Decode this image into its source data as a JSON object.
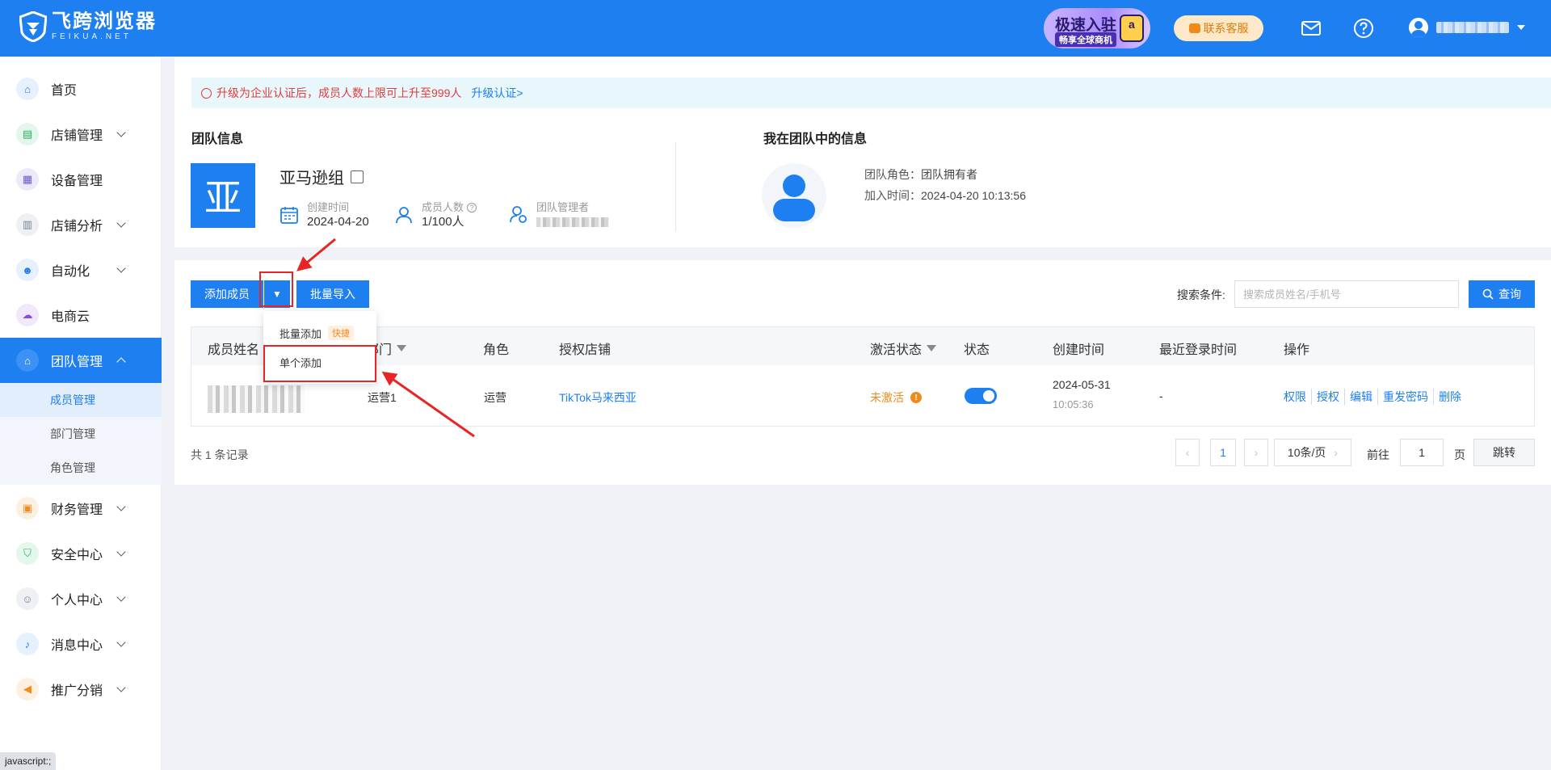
{
  "header": {
    "logo_cn": "飞跨浏览器",
    "logo_en": "FEIKUA.NET",
    "promo_line1": "极速入驻",
    "promo_line2": "畅享全球商机",
    "support_label": "联系客服",
    "mail_icon": "mail-icon",
    "help_icon": "help-icon",
    "brand_color": "#1e7ff0"
  },
  "sidebar": {
    "items": [
      {
        "label": "首页",
        "icon": "home-icon"
      },
      {
        "label": "店铺管理",
        "icon": "store-icon"
      },
      {
        "label": "设备管理",
        "icon": "device-icon"
      },
      {
        "label": "店铺分析",
        "icon": "analysis-icon"
      },
      {
        "label": "自动化",
        "icon": "robot-icon"
      },
      {
        "label": "电商云",
        "icon": "cloud-icon"
      },
      {
        "label": "团队管理",
        "icon": "team-icon"
      },
      {
        "label": "财务管理",
        "icon": "wallet-icon"
      },
      {
        "label": "安全中心",
        "icon": "shield-icon"
      },
      {
        "label": "个人中心",
        "icon": "user-icon"
      },
      {
        "label": "消息中心",
        "icon": "bell-icon"
      },
      {
        "label": "推广分销",
        "icon": "megaphone-icon"
      }
    ],
    "sub_items": [
      "成员管理",
      "部门管理",
      "角色管理"
    ]
  },
  "notice": {
    "text": "升级为企业认证后，成员人数上限可上升至999人",
    "link": "升级认证>"
  },
  "team_info": {
    "section_title": "团队信息",
    "logo_char": "亚",
    "name": "亚马逊组",
    "created_label": "创建时间",
    "created_value": "2024-04-20",
    "members_label": "成员人数",
    "members_value": "1/100人",
    "admin_label": "团队管理者"
  },
  "my_info": {
    "section_title": "我在团队中的信息",
    "role_label": "团队角色：",
    "role_value": "团队拥有者",
    "join_label": "加入时间：",
    "join_value": "2024-04-20 10:13:56"
  },
  "toolbar": {
    "add_member": "添加成员",
    "dropdown_toggle": "▼",
    "batch_import": "批量导入",
    "search_label": "搜索条件:",
    "search_placeholder": "搜索成员姓名/手机号",
    "query_button": "查询"
  },
  "dropdown": {
    "batch_add": "批量添加",
    "batch_badge": "快捷",
    "single_add": "单个添加"
  },
  "table": {
    "headers": [
      "成员姓名",
      "部门",
      "角色",
      "授权店铺",
      "激活状态",
      "状态",
      "创建时间",
      "最近登录时间",
      "操作"
    ],
    "rows": [
      {
        "department": "运营1",
        "role": "运营",
        "store": "TikTok马来西亚",
        "activation": "未激活",
        "status_on": true,
        "created_date": "2024-05-31",
        "created_time": "10:05:36",
        "last_login": "-",
        "actions": [
          "权限",
          "授权",
          "编辑",
          "重发密码",
          "删除"
        ]
      }
    ]
  },
  "pagination": {
    "total": "共 1 条记录",
    "current_page": "1",
    "page_size": "10条/页",
    "goto_label": "前往",
    "goto_value": "1",
    "page_unit": "页",
    "jump_button": "跳转"
  },
  "statusbar": "javascript:;"
}
